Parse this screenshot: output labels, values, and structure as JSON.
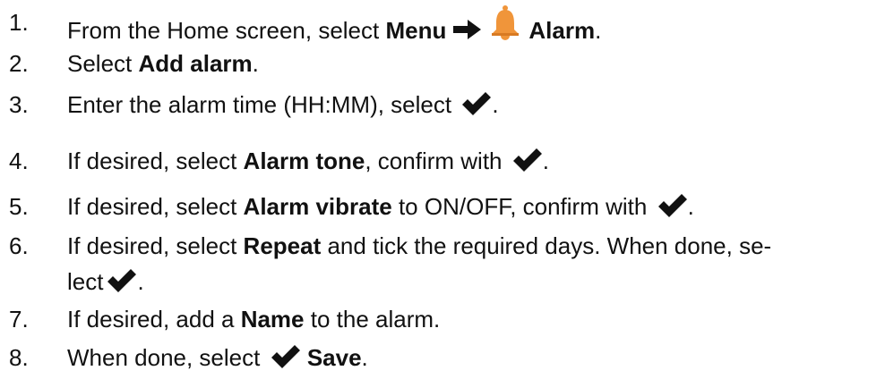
{
  "icons": {
    "check": "check-icon",
    "arrow": "arrow-right-icon",
    "bell": "bell-icon"
  },
  "colors": {
    "bell": "#F0953A",
    "text": "#111111"
  },
  "steps": [
    {
      "num": "1.",
      "parts": {
        "a": "From the Home screen, select ",
        "b1": "Menu",
        "b2": "Alarm",
        "end": "."
      }
    },
    {
      "num": "2.",
      "parts": {
        "a": "Select ",
        "b1": "Add alarm",
        "end": "."
      }
    },
    {
      "num": "3.",
      "parts": {
        "a": "Enter the alarm time (HH:MM), select ",
        "end": "."
      }
    },
    {
      "num": "4.",
      "parts": {
        "a": "If desired, select ",
        "b1": "Alarm tone",
        "c": ", confirm with ",
        "end": "."
      }
    },
    {
      "num": "5.",
      "parts": {
        "a": "If desired, select ",
        "b1": "Alarm vibrate",
        "c": " to ON/OFF, confirm with ",
        "end": "."
      }
    },
    {
      "num": "6.",
      "parts": {
        "a": "If desired, select ",
        "b1": "Repeat",
        "c": " and tick the required days. When done, se-",
        "d": "lect",
        "end": "."
      }
    },
    {
      "num": "7.",
      "parts": {
        "a": "If desired, add a ",
        "b1": "Name",
        "c": " to the alarm."
      }
    },
    {
      "num": "8.",
      "parts": {
        "a": "When done, select ",
        "b1": "Save",
        "end": "."
      }
    }
  ]
}
